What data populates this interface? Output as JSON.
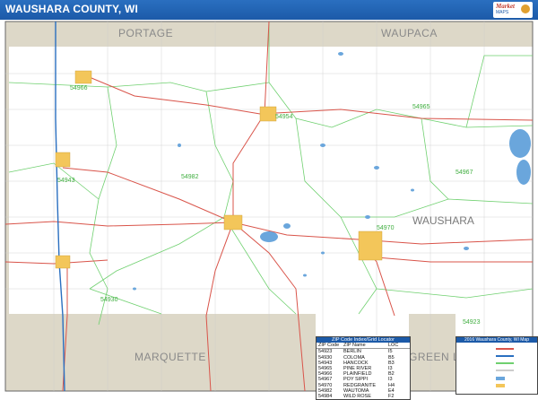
{
  "header": {
    "title": "WAUSHARA COUNTY, WI"
  },
  "counties": {
    "portage": "PORTAGE",
    "waupaca": "WAUPACA",
    "waushara": "WAUSHARA",
    "marquette": "MARQUETTE",
    "green_lake": "GREEN LA"
  },
  "zip_labels": {
    "z54966": "54966",
    "z54954": "54954",
    "z54965": "54965",
    "z54943": "54943",
    "z54982": "54982",
    "z54967": "54967",
    "z54970": "54970",
    "z54930": "54930",
    "z54923": "54923"
  },
  "zip_index": {
    "title": "ZIP Code Index/Grid Locator",
    "columns": [
      "ZIP Code",
      "ZIP Name",
      "LOC"
    ],
    "rows": [
      [
        "54923",
        "BERLIN",
        "I5"
      ],
      [
        "54930",
        "COLOMA",
        "B5"
      ],
      [
        "54943",
        "HANCOCK",
        "B3"
      ],
      [
        "54965",
        "PINE RIVER",
        "I3"
      ],
      [
        "54966",
        "PLAINFIELD",
        "B2"
      ],
      [
        "54967",
        "POY SIPPI",
        "I3"
      ],
      [
        "54970",
        "REDGRANITE",
        "H4"
      ],
      [
        "54982",
        "WAUTOMA",
        "E4"
      ],
      [
        "54984",
        "WILD ROSE",
        "F2"
      ]
    ]
  },
  "legend": {
    "title": "2016 Waushara County, WI Map"
  },
  "colors": {
    "header_bg": "#1c5aa8",
    "neighbor_fill": "#ddd8c8",
    "road": "#d9544a",
    "zip_boundary": "#6fd06f",
    "water": "#6aa6dc",
    "city": "#f3c65a"
  }
}
